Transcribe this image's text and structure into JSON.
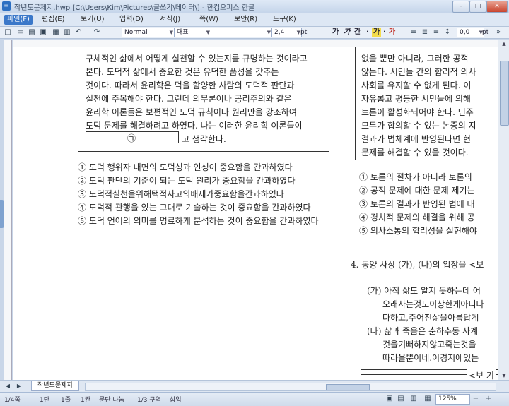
{
  "window": {
    "title": "작년도문제지.hwp [C:\\Users\\Kim\\Pictures\\글쓰기\\데이터\\] - 한컴오피스 한글",
    "app_icon": "doc-icon",
    "buttons": [
      "–",
      "□",
      "✕"
    ]
  },
  "menu": [
    "파일(F)",
    "편집(E)",
    "보기(U)",
    "입력(D)",
    "서식(J)",
    "쪽(W)",
    "보안(R)",
    "도구(K)"
  ],
  "toolbar": {
    "style": "Normal",
    "font_lang": "대표",
    "font": "",
    "size": "2,4",
    "size_unit": "pt",
    "fmt": [
      "가",
      "가",
      "간",
      "·",
      "가",
      "·",
      "가"
    ],
    "spacing": "0,0",
    "spacing_unit": "pt"
  },
  "doc": {
    "left_box": [
      "구체적인 삶에서 어떻게 실천할 수 있는지를 규명하는 것이라고",
      "본다. 도덕적 삶에서 중요한 것은 유덕한 품성을 갖추는",
      "것이다. 따라서 윤리학은 덕을 함양한 사람의 도덕적 판단과",
      "실천에 주목해야 한다. 그런데 의무론이나 공리주의와 같은",
      "윤리학 이론들은 보편적인 도덕 규칙이나 원리만을 강조하여",
      "도덕 문제를 해결하려고 하였다. 나는 이러한 윤리학 이론들이"
    ],
    "blank_marker": "㉠",
    "blank_tail": "고 생각한다.",
    "left_options": [
      "① 도덕 행위자 내면의 도덕성과 인성이 중요함을 간과하였다",
      "② 도덕 판단의 기준이 되는 도덕 원리가 중요함을 간과하였다",
      "③ 도덕적실천을위해택적사고의배제가중요함을간과하였다",
      "④ 도덕적 관행을 있는 그대로 기술하는 것이 중요함을 간과하였다",
      "⑤ 도덕 언어의 의미를 명료하게 분석하는 것이 중요함을 간과하였다"
    ],
    "right_box": [
      "없을 뿐만 아니라, 그러한 공적",
      "않는다. 시민들 간의 합리적 의사",
      "사회를 유지할 수 없게 된다. 이",
      "자유롭고 평등한 시민들에 의해",
      "토론이 활성화되어야 한다. 민주",
      "모두가 합의할 수 있는 논증의 지",
      "결과가 법체계에 반영된다면 현",
      "문제를 해결할 수 있을 것이다."
    ],
    "right_options": [
      "① 토론의 절차가 아니라 토론의",
      "② 공적 문제에 대한 문제 제기는",
      "③ 토론의 결과가 반영된 법에 대",
      "④ 경치적 문제의 해결을 위해 공",
      "⑤ 의사소통의 합리성을 실현해야"
    ],
    "q4": "4. 동양 사상 (가), (나)의 입장을 <보",
    "q4_box": [
      "(가) 아직 삶도 알지 못하는데 어",
      "오래사는것도이상한게아니다",
      "다하고,주어진삶을아름답게",
      "(나) 삶과 죽음은 춘하추동 사계",
      "것을기뻐하지않고죽는것을",
      "따라올뿐이네.이경지에있는"
    ],
    "q4_tail": "<보 기"
  },
  "tab": "작년도문제지",
  "status": {
    "page": "1/4쪽",
    "section": "1단",
    "line": "1줄",
    "col": "1칸",
    "split": "문단 나눔",
    "area": "1/3 구역",
    "mode": "삽입",
    "zoom": "125%"
  }
}
